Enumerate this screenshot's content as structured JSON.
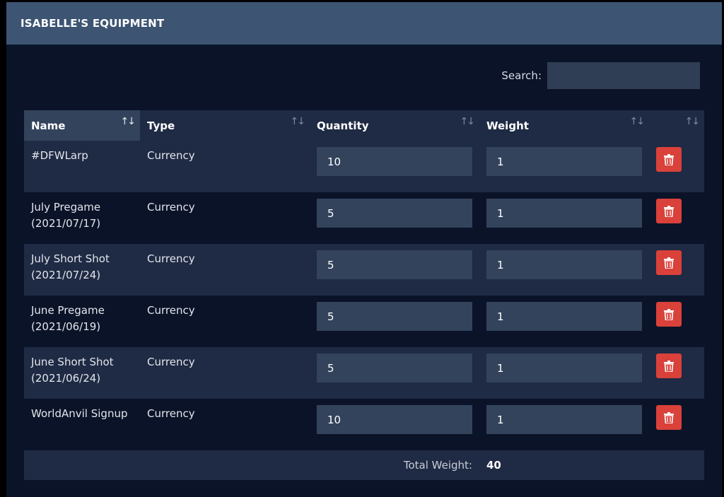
{
  "panel": {
    "title": "ISABELLE'S EQUIPMENT"
  },
  "search": {
    "label": "Search:",
    "value": "",
    "placeholder": ""
  },
  "table": {
    "columns": [
      {
        "label": "Name",
        "sortable": true,
        "sorted": true
      },
      {
        "label": "Type",
        "sortable": true,
        "sorted": false
      },
      {
        "label": "Quantity",
        "sortable": true,
        "sorted": false
      },
      {
        "label": "Weight",
        "sortable": true,
        "sorted": false
      },
      {
        "label": "",
        "sortable": true,
        "sorted": false
      }
    ],
    "sort_icon": "sort-arrows-icon",
    "rows": [
      {
        "name_line1": "#DFWLarp",
        "name_line2": "",
        "type": "Currency",
        "quantity": "10",
        "weight": "1"
      },
      {
        "name_line1": "July Pregame",
        "name_line2": "(2021/07/17)",
        "type": "Currency",
        "quantity": "5",
        "weight": "1"
      },
      {
        "name_line1": "July Short Shot",
        "name_line2": "(2021/07/24)",
        "type": "Currency",
        "quantity": "5",
        "weight": "1"
      },
      {
        "name_line1": "June Pregame",
        "name_line2": "(2021/06/19)",
        "type": "Currency",
        "quantity": "5",
        "weight": "1"
      },
      {
        "name_line1": "June Short Shot",
        "name_line2": "(2021/06/24)",
        "type": "Currency",
        "quantity": "5",
        "weight": "1"
      },
      {
        "name_line1": "WorldAnvil Signup",
        "name_line2": "",
        "type": "Currency",
        "quantity": "10",
        "weight": "1"
      }
    ],
    "delete_icon": "trash-icon",
    "footer": {
      "total_label": "Total Weight:",
      "total_value": "40"
    }
  },
  "colors": {
    "header_bg": "#3d5573",
    "panel_bg": "#0b1328",
    "row_alt_bg": "#1f2a44",
    "input_bg": "#34435c",
    "delete_button": "#d9413a"
  }
}
